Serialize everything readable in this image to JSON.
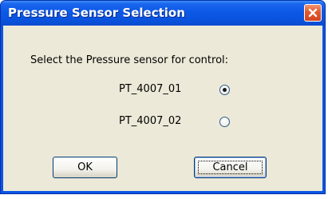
{
  "window": {
    "title": "Pressure Sensor Selection"
  },
  "dialog": {
    "prompt": "Select the Pressure sensor for control:",
    "options": [
      {
        "label": "PT_4007_01",
        "selected": true
      },
      {
        "label": "PT_4007_02",
        "selected": false
      }
    ],
    "buttons": {
      "ok": "OK",
      "cancel": "Cancel"
    }
  },
  "icons": {
    "close": "close-icon"
  },
  "colors": {
    "titlebar": "#0a56e3",
    "close_button": "#e3582d",
    "client_background": "#ece9d8"
  }
}
